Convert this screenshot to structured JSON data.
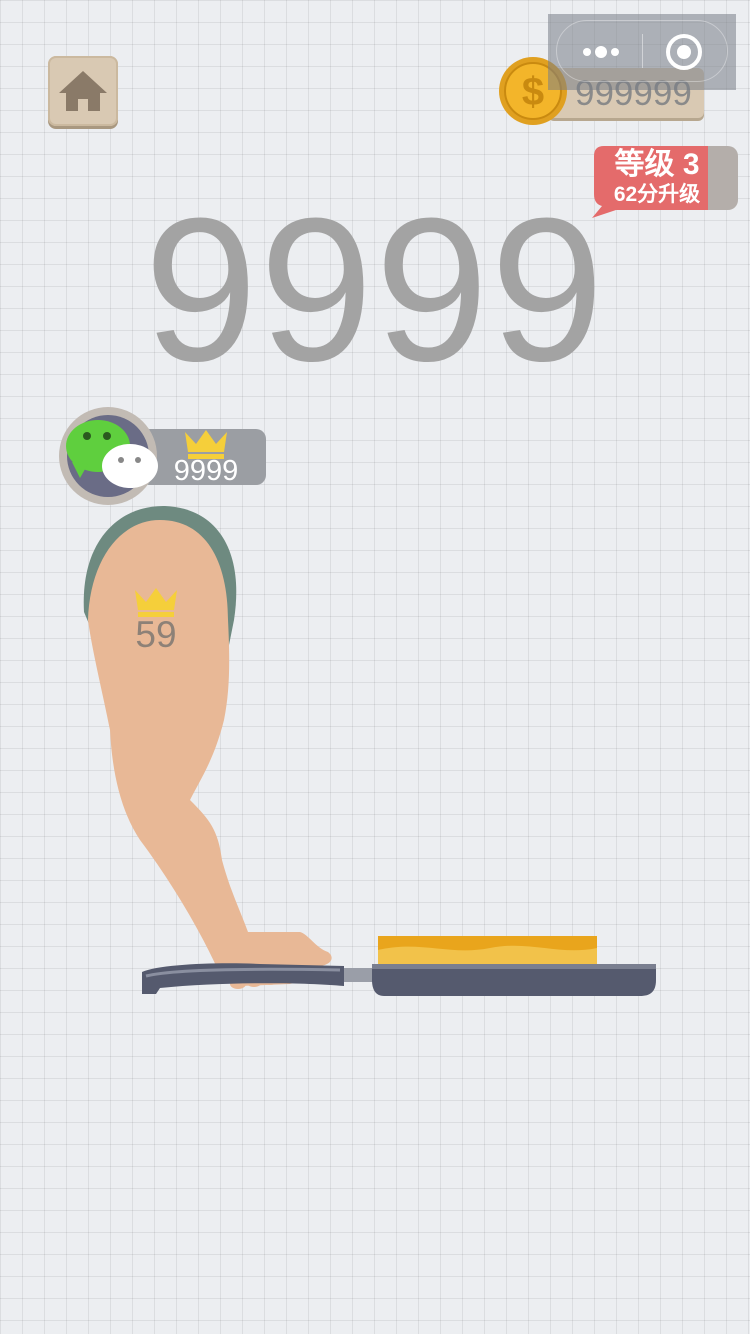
{
  "colors": {
    "background": "#eceef1",
    "accent_red": "#e46b6b",
    "coin_gold": "#f3b52a",
    "crown_yellow": "#f5cf3a",
    "pan": "#555a6e",
    "food": "#e9a51c",
    "skin": "#e8b896",
    "sleeve": "#6e8a80"
  },
  "icons": {
    "home": "home-icon",
    "coin": "dollar-coin-icon",
    "menu": "more-dots-icon",
    "close": "target-close-icon",
    "crown": "crown-icon",
    "avatar": "wechat-avatar-icon"
  },
  "coins": {
    "value": "999999"
  },
  "level": {
    "title": "等级 3",
    "subtitle": "62分升级"
  },
  "score": {
    "current": "9999"
  },
  "best": {
    "score": "9999"
  },
  "arm": {
    "level": "59"
  }
}
